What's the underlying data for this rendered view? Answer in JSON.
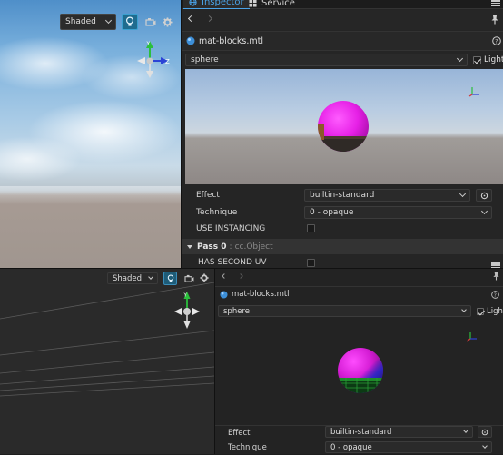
{
  "scene_top": {
    "shading_select": "Shaded"
  },
  "scene_bottom": {
    "shading_select": "Shaded"
  },
  "inspector_top": {
    "tabs": [
      {
        "label": "Inspector"
      },
      {
        "label": "Service"
      }
    ],
    "asset_name": "mat-blocks.mtl",
    "preview_mesh": "sphere",
    "light_label": "Light",
    "properties": {
      "effect_label": "Effect",
      "effect_value": "builtin-standard",
      "technique_label": "Technique",
      "technique_value": "0 - opaque",
      "use_instancing_label": "USE INSTANCING"
    },
    "pass": {
      "title": "Pass 0",
      "type": "cc.Object",
      "has_second_uv_label": "HAS SECOND UV"
    }
  },
  "inspector_bottom": {
    "asset_name": "mat-blocks.mtl",
    "preview_mesh": "sphere",
    "light_label": "Light",
    "properties": {
      "effect_label": "Effect",
      "effect_value": "builtin-standard",
      "technique_label": "Technique",
      "technique_value": "0 - opaque"
    }
  },
  "colors": {
    "accent": "#4aa3e8",
    "sphere_magenta": "#e620e6",
    "gizmo_z": "#2c43d6",
    "gizmo_y": "#2bbf3c"
  }
}
